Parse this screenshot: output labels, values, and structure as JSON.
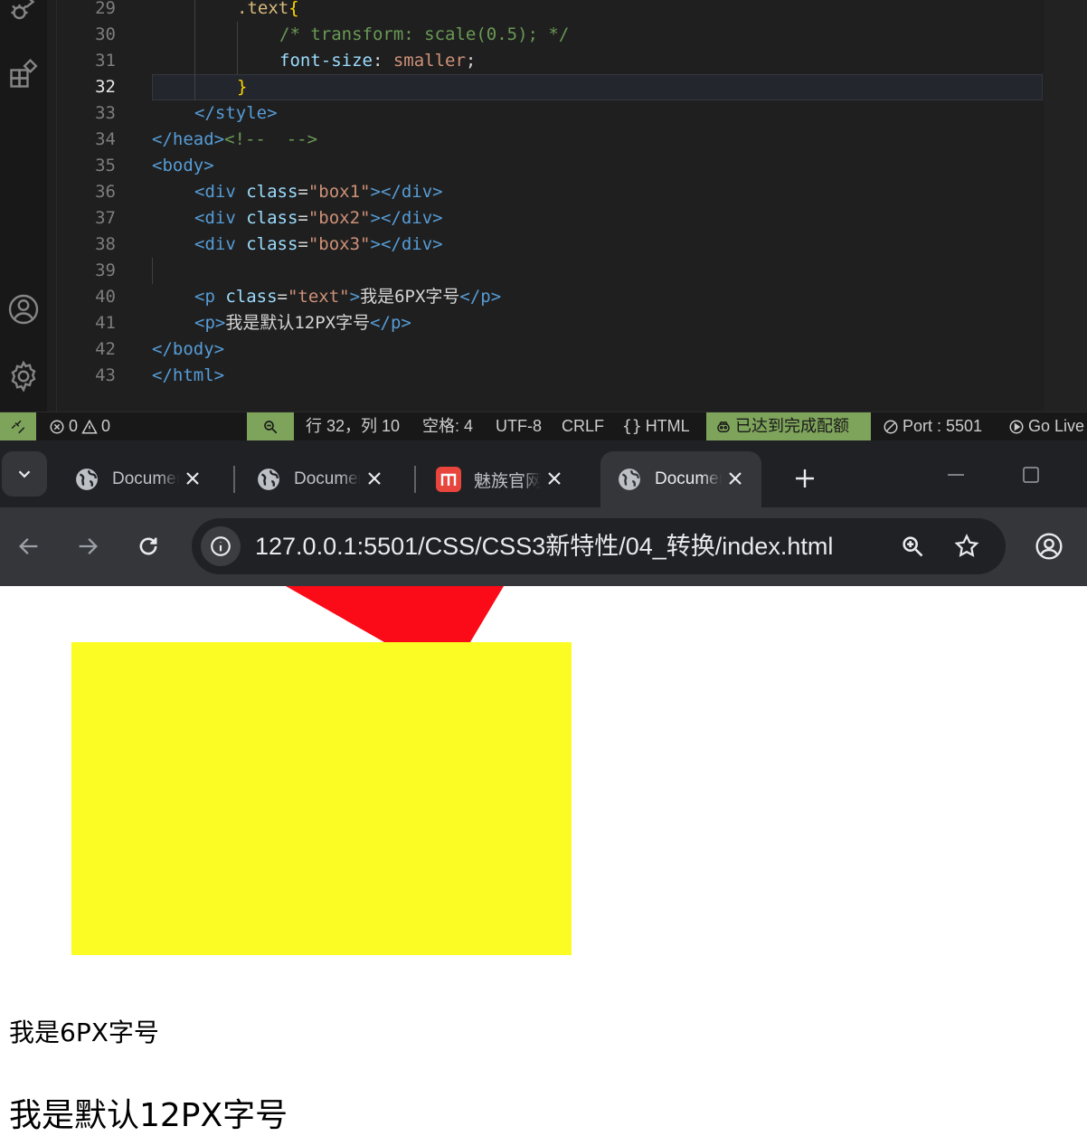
{
  "editor": {
    "lines": [
      {
        "num": "29",
        "tokens": [
          {
            "t": ".text",
            "c": "t-sel"
          },
          {
            "t": "{",
            "c": "t-br"
          }
        ],
        "indent": 2
      },
      {
        "num": "30",
        "tokens": [
          {
            "t": "/* transform: scale(0.5); */",
            "c": "t-cm"
          }
        ],
        "indent": 3
      },
      {
        "num": "31",
        "tokens": [
          {
            "t": "font-size",
            "c": "t-prop"
          },
          {
            "t": ": ",
            "c": "t-txt"
          },
          {
            "t": "smaller",
            "c": "t-val"
          },
          {
            "t": ";",
            "c": "t-txt"
          }
        ],
        "indent": 3
      },
      {
        "num": "32",
        "tokens": [
          {
            "t": "}",
            "c": "t-br"
          }
        ],
        "indent": 2,
        "active": true
      },
      {
        "num": "33",
        "tokens": [
          {
            "t": "</",
            "c": "t-tag"
          },
          {
            "t": "style",
            "c": "t-tag"
          },
          {
            "t": ">",
            "c": "t-tag"
          }
        ],
        "indent": 1
      },
      {
        "num": "34",
        "tokens": [
          {
            "t": "</",
            "c": "t-tag"
          },
          {
            "t": "head",
            "c": "t-tag"
          },
          {
            "t": ">",
            "c": "t-tag"
          },
          {
            "t": "<!--  -->",
            "c": "t-cm"
          }
        ],
        "indent": 0
      },
      {
        "num": "35",
        "tokens": [
          {
            "t": "<",
            "c": "t-tag"
          },
          {
            "t": "body",
            "c": "t-tag"
          },
          {
            "t": ">",
            "c": "t-tag"
          }
        ],
        "indent": 0
      },
      {
        "num": "36",
        "tokens": [
          {
            "t": "<div ",
            "c": "t-tag"
          },
          {
            "t": "class",
            "c": "t-attr"
          },
          {
            "t": "=",
            "c": "t-txt"
          },
          {
            "t": "\"box1\"",
            "c": "t-str"
          },
          {
            "t": "></div>",
            "c": "t-tag"
          }
        ],
        "indent": 1
      },
      {
        "num": "37",
        "tokens": [
          {
            "t": "<div ",
            "c": "t-tag"
          },
          {
            "t": "class",
            "c": "t-attr"
          },
          {
            "t": "=",
            "c": "t-txt"
          },
          {
            "t": "\"box2\"",
            "c": "t-str"
          },
          {
            "t": "></div>",
            "c": "t-tag"
          }
        ],
        "indent": 1
      },
      {
        "num": "38",
        "tokens": [
          {
            "t": "<div ",
            "c": "t-tag"
          },
          {
            "t": "class",
            "c": "t-attr"
          },
          {
            "t": "=",
            "c": "t-txt"
          },
          {
            "t": "\"box3\"",
            "c": "t-str"
          },
          {
            "t": "></div>",
            "c": "t-tag"
          }
        ],
        "indent": 1
      },
      {
        "num": "39",
        "tokens": [],
        "indent": 1
      },
      {
        "num": "40",
        "tokens": [
          {
            "t": "<p ",
            "c": "t-tag"
          },
          {
            "t": "class",
            "c": "t-attr"
          },
          {
            "t": "=",
            "c": "t-txt"
          },
          {
            "t": "\"text\"",
            "c": "t-str"
          },
          {
            "t": ">",
            "c": "t-tag"
          },
          {
            "t": "我是6PX字号",
            "c": "t-txt"
          },
          {
            "t": "</p>",
            "c": "t-tag"
          }
        ],
        "indent": 1
      },
      {
        "num": "41",
        "tokens": [
          {
            "t": "<p>",
            "c": "t-tag"
          },
          {
            "t": "我是默认12PX字号",
            "c": "t-txt"
          },
          {
            "t": "</p>",
            "c": "t-tag"
          }
        ],
        "indent": 1
      },
      {
        "num": "42",
        "tokens": [
          {
            "t": "</body>",
            "c": "t-tag"
          }
        ],
        "indent": 0
      },
      {
        "num": "43",
        "tokens": [
          {
            "t": "</html>",
            "c": "t-tag"
          }
        ],
        "indent": 0
      }
    ]
  },
  "statusbar": {
    "errors": "0",
    "warnings": "0",
    "cursor": "行 32，列 10",
    "spaces": "空格: 4",
    "encoding": "UTF-8",
    "eol": "CRLF",
    "language": "HTML",
    "copilot": "已达到完成配额",
    "port": "Port : 5501",
    "golive": "Go Live"
  },
  "browser": {
    "tabs": [
      {
        "title": "Document",
        "icon": "globe-icon",
        "active": false
      },
      {
        "title": "Document",
        "icon": "globe-icon",
        "active": false
      },
      {
        "title": "魅族官网",
        "icon": "meizu-icon",
        "active": false
      },
      {
        "title": "Document",
        "icon": "globe-icon",
        "active": true
      }
    ],
    "url": "127.0.0.1:5501/CSS/CSS3新特性/04_转换/index.html"
  },
  "page": {
    "text_small": "我是6PX字号",
    "text_default": "我是默认12PX字号",
    "colors": {
      "red": "#fb0a17",
      "yellow": "#fbfc24"
    }
  }
}
